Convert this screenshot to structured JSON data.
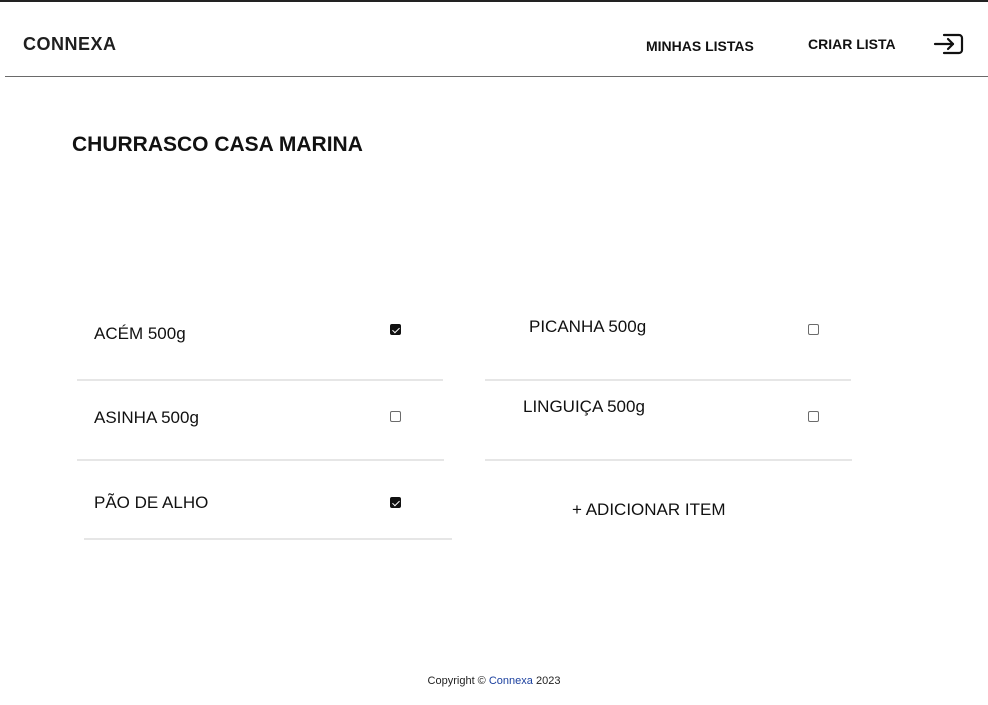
{
  "header": {
    "logo": "CONNEXA",
    "nav": {
      "my_lists": "MINHAS LISTAS",
      "create_list": "CRIAR LISTA"
    },
    "logout_icon": "logout-arrow-icon"
  },
  "main": {
    "title": "CHURRASCO CASA MARINA",
    "items": [
      {
        "label": "ACÉM 500g",
        "checked": true
      },
      {
        "label": "PICANHA 500g",
        "checked": false
      },
      {
        "label": "ASINHA 500g",
        "checked": false
      },
      {
        "label": "LINGUIÇA 500g",
        "checked": false
      },
      {
        "label": "PÃO DE ALHO",
        "checked": true
      }
    ],
    "add_item_label": "+ ADICIONAR ITEM"
  },
  "footer": {
    "prefix": "Copyright ©",
    "brand": "Connexa",
    "year": "2023"
  },
  "colors": {
    "brand_link": "#1a3f9e",
    "divider": "#e6e6e6",
    "header_border": "#6a6a6a"
  }
}
